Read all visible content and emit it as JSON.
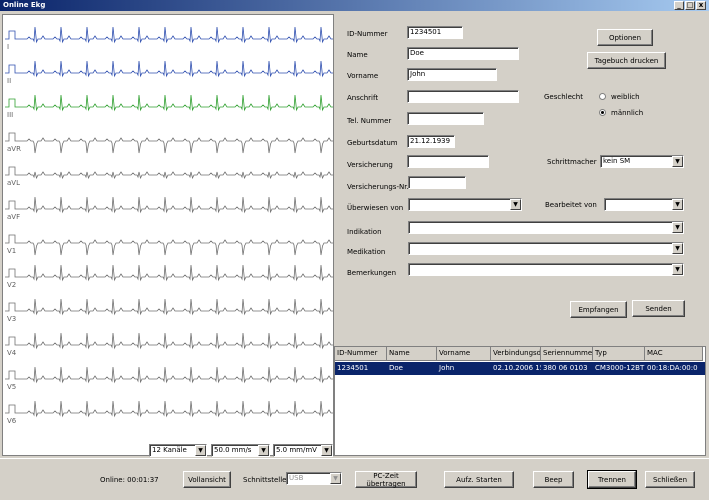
{
  "window": {
    "title": "Online Ekg",
    "min": "_",
    "max": "□",
    "close": "x"
  },
  "ecg": {
    "leads": [
      "I",
      "II",
      "III",
      "aVR",
      "aVL",
      "aVF",
      "V1",
      "V2",
      "V3",
      "V4",
      "V5",
      "V6"
    ],
    "colors": {
      "I": "#3050b0",
      "II": "#3050b0",
      "III": "#30a030",
      "default": "#707070"
    },
    "channels_select": "12 Kanäle",
    "speed_select": "50.0 mm/s",
    "gain_select": "5.0 mm/mV"
  },
  "form": {
    "id_label": "ID-Nummer",
    "id_value": "1234501",
    "name_label": "Name",
    "name_value": "Doe",
    "vorname_label": "Vorname",
    "vorname_value": "John",
    "anschrift_label": "Anschrift",
    "anschrift_value": "",
    "tel_label": "Tel. Nummer",
    "tel_value": "",
    "geburt_label": "Geburtsdatum",
    "geburt_value": "21.12.1939",
    "versicherung_label": "Versicherung",
    "versicherung_value": "",
    "versnr_label": "Versicherungs-Nr.",
    "versnr_value": "",
    "ueberwiesen_label": "Überwiesen von",
    "ueberwiesen_value": "",
    "indikation_label": "Indikation",
    "indikation_value": "",
    "medikation_label": "Medikation",
    "medikation_value": "",
    "bemerkungen_label": "Bemerkungen",
    "bemerkungen_value": "",
    "geschlecht_label": "Geschlecht",
    "weiblich_label": "weiblich",
    "maennlich_label": "männlich",
    "gender_selected": "männlich",
    "schrittmacher_label": "Schrittmacher",
    "schrittmacher_value": "kein SM",
    "bearbeitet_label": "Bearbeitet von",
    "bearbeitet_value": "",
    "optionen_button": "Optionen",
    "tagebuch_button": "Tagebuch drucken",
    "empfangen_button": "Empfangen",
    "senden_button": "Senden"
  },
  "table": {
    "columns": [
      "ID-Nummer",
      "Name",
      "Vorname",
      "Verbindungsda",
      "Seriennummer",
      "Typ",
      "MAC"
    ],
    "rows": [
      [
        "1234501",
        "Doe",
        "John",
        "02.10.2006 15",
        "380 06 0103",
        "CM3000-12BT",
        "00:18:DA:00:0"
      ]
    ]
  },
  "statusbar": {
    "online_text": "Online: 00:01:37",
    "vollansicht_button": "Vollansicht",
    "schnittstelle_label": "Schnittstelle",
    "schnittstelle_value": "USB",
    "pczeit_button": "PC-Zeit übertragen",
    "aufz_button": "Aufz. Starten",
    "beep_button": "Beep",
    "trennen_button": "Trennen",
    "schliessen_button": "Schließen"
  }
}
